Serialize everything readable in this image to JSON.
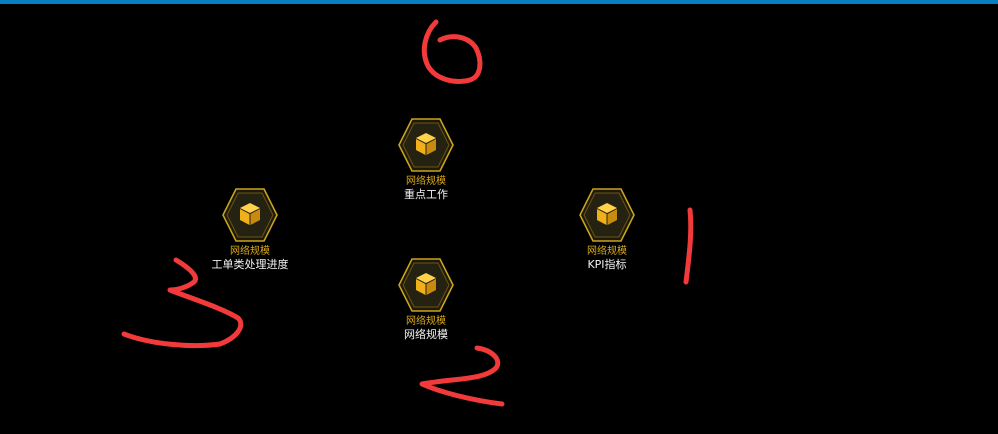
{
  "colors": {
    "background": "#000000",
    "top_bar": "#0a7ec2",
    "hex_border": "#c9a31e",
    "icon": "#f0b01a",
    "category_text": "#d8a81c",
    "label_text": "#f2f2f2",
    "annotation": "#f23a3a"
  },
  "nodes": [
    {
      "icon": "cube-icon",
      "category": "网络规模",
      "label": "重点工作"
    },
    {
      "icon": "cube-icon",
      "category": "网络规模",
      "label": "KPI指标"
    },
    {
      "icon": "cube-icon",
      "category": "网络规模",
      "label": "网络规模"
    },
    {
      "icon": "cube-icon",
      "category": "网络规模",
      "label": "工单类处理进度"
    }
  ],
  "annotations": [
    "0",
    "1",
    "2",
    "3"
  ]
}
